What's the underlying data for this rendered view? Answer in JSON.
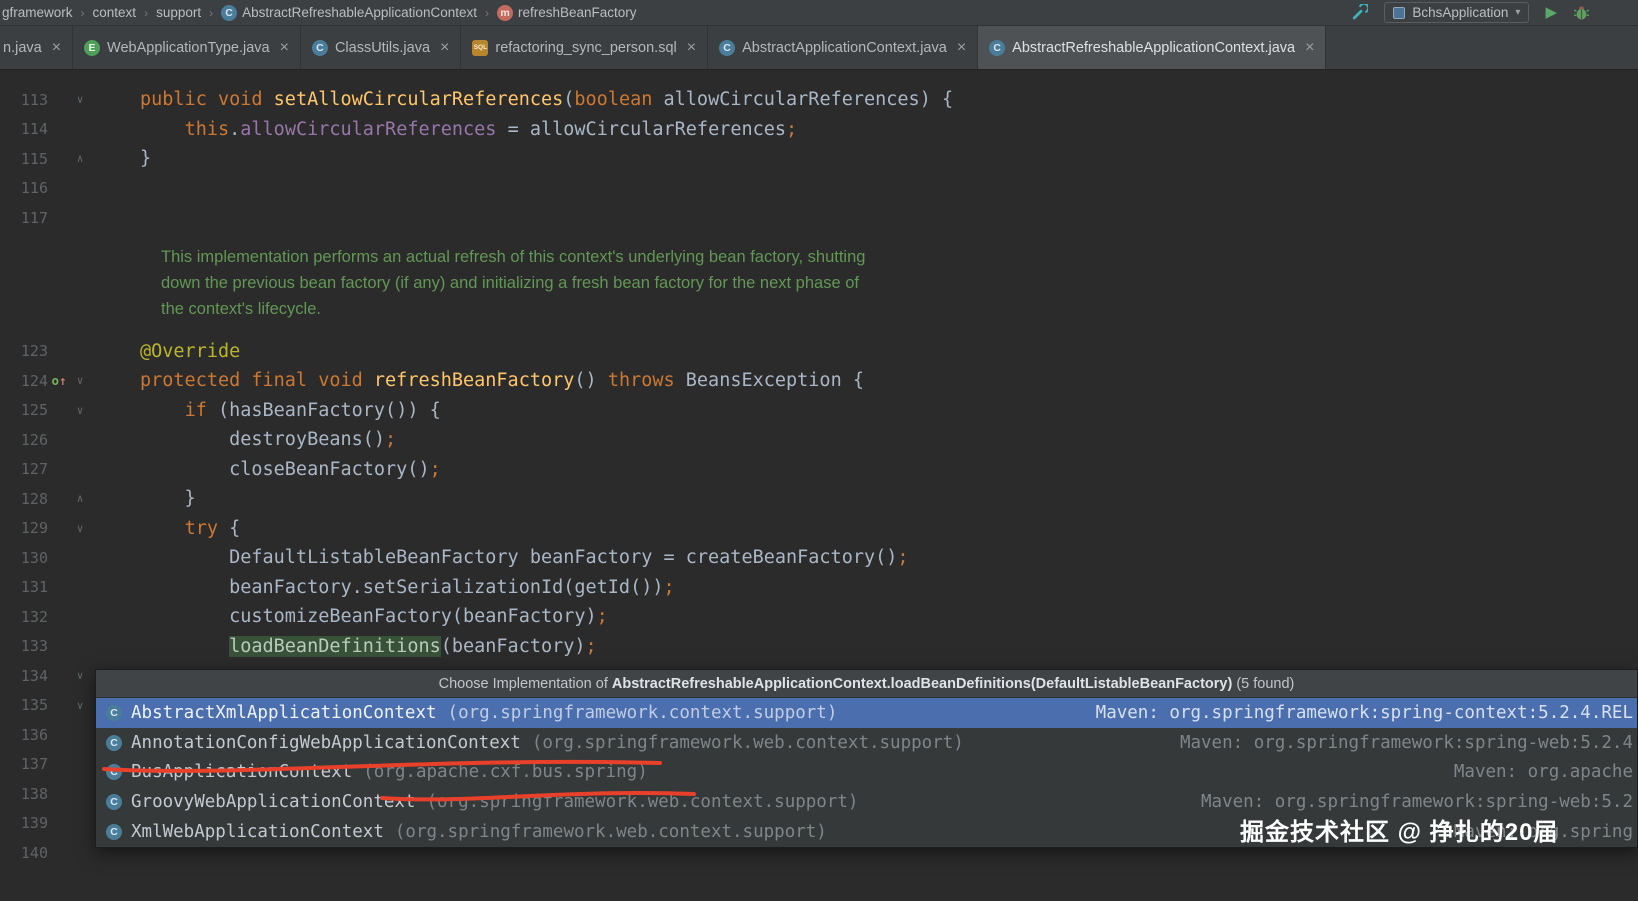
{
  "theme": {
    "editor_bg": "#2b2b2b",
    "panel_bg": "#3c3f41",
    "selection_blue": "#4b6eaf",
    "keyword_orange": "#cc7832",
    "method_decl_yellow": "#ffc66b",
    "plain_text": "#a9b7c6",
    "field_purple": "#9876aa",
    "annotation_yellow": "#bbb529",
    "doc_comment_green": "#629755",
    "line_number_gray": "#606366",
    "usage_highlight_green": "#375239",
    "annotation_red": "#e8402a",
    "run_green": "#59a869"
  },
  "icons": {
    "class": {
      "glyph": "C",
      "bg": "#4a7d9a",
      "fg": "#d6e9f5",
      "shape": "circle"
    },
    "enum": {
      "glyph": "E",
      "bg": "#4f9e59",
      "fg": "#e2f3e4",
      "shape": "circle"
    },
    "method": {
      "glyph": "m",
      "bg": "#c56b5d",
      "fg": "#f7e3df",
      "shape": "circle"
    },
    "sql": {
      "glyph": "SQL",
      "bg": "#b8862c",
      "fg": "#f5ead2",
      "shape": "square"
    },
    "close": {
      "glyph": "×"
    },
    "dropdown": {
      "glyph": "▾"
    },
    "run": {
      "glyph": "▶"
    },
    "fold_down": {
      "glyph": "∨"
    },
    "fold_up": {
      "glyph": "∧"
    },
    "override": {
      "glyph": "o↑"
    }
  },
  "breadcrumbs": {
    "separator": "›",
    "items": [
      {
        "label": "gframework"
      },
      {
        "label": "context"
      },
      {
        "label": "support"
      },
      {
        "label": "AbstractRefreshableApplicationContext",
        "icon": "class"
      },
      {
        "label": "refreshBeanFactory",
        "icon": "method"
      }
    ]
  },
  "toolbar": {
    "run_config": "BchsApplication"
  },
  "tabs": [
    {
      "label": "n.java",
      "icon": null,
      "active": false
    },
    {
      "label": "WebApplicationType.java",
      "icon": "enum",
      "active": false
    },
    {
      "label": "ClassUtils.java",
      "icon": "class",
      "active": false
    },
    {
      "label": "refactoring_sync_person.sql",
      "icon": "sql",
      "active": false
    },
    {
      "label": "AbstractApplicationContext.java",
      "icon": "class",
      "active": false
    },
    {
      "label": "AbstractRefreshableApplicationContext.java",
      "icon": "class",
      "active": true
    }
  ],
  "editor": {
    "rows": [
      {
        "num": "113",
        "fold": "down",
        "segs": [
          {
            "c": "kw",
            "t": "public "
          },
          {
            "c": "kw",
            "t": "void "
          },
          {
            "c": "decl",
            "t": "setAllowCircularReferences"
          },
          {
            "c": "plain",
            "t": "("
          },
          {
            "c": "kw",
            "t": "boolean "
          },
          {
            "c": "plain",
            "t": "allowCircularReferences) {"
          }
        ]
      },
      {
        "num": "114",
        "segs": [
          {
            "c": "plain",
            "t": "    "
          },
          {
            "c": "kw",
            "t": "this"
          },
          {
            "c": "plain",
            "t": "."
          },
          {
            "c": "field",
            "t": "allowCircularReferences"
          },
          {
            "c": "plain",
            "t": " = allowCircularReferences"
          },
          {
            "c": "semi",
            "t": ";"
          }
        ]
      },
      {
        "num": "115",
        "fold": "up",
        "segs": [
          {
            "c": "plain",
            "t": "}"
          }
        ]
      },
      {
        "num": "116",
        "segs": []
      },
      {
        "num": "117",
        "segs": []
      },
      {
        "kind": "spacer",
        "h": 12
      },
      {
        "kind": "doc",
        "text": "This implementation performs an actual refresh of this context's underlying bean factory, shutting"
      },
      {
        "kind": "doc",
        "text": "down the previous bean factory (if any) and initializing a fresh bean factory for the next phase of"
      },
      {
        "kind": "doc",
        "text": "the context's lifecycle."
      },
      {
        "kind": "spacer",
        "h": 14
      },
      {
        "num": "123",
        "segs": [
          {
            "c": "ann",
            "t": "@Override"
          }
        ]
      },
      {
        "num": "124",
        "fold": "down",
        "override": true,
        "segs": [
          {
            "c": "kw",
            "t": "protected final void "
          },
          {
            "c": "decl",
            "t": "refreshBeanFactory"
          },
          {
            "c": "plain",
            "t": "() "
          },
          {
            "c": "kw",
            "t": "throws "
          },
          {
            "c": "plain",
            "t": "BeansException {"
          }
        ]
      },
      {
        "num": "125",
        "fold": "down",
        "segs": [
          {
            "c": "plain",
            "t": "    "
          },
          {
            "c": "kw",
            "t": "if "
          },
          {
            "c": "plain",
            "t": "(hasBeanFactory()) {"
          }
        ]
      },
      {
        "num": "126",
        "segs": [
          {
            "c": "plain",
            "t": "        destroyBeans()"
          },
          {
            "c": "semi",
            "t": ";"
          }
        ]
      },
      {
        "num": "127",
        "segs": [
          {
            "c": "plain",
            "t": "        closeBeanFactory()"
          },
          {
            "c": "semi",
            "t": ";"
          }
        ]
      },
      {
        "num": "128",
        "fold": "up",
        "segs": [
          {
            "c": "plain",
            "t": "    }"
          }
        ]
      },
      {
        "num": "129",
        "fold": "down",
        "segs": [
          {
            "c": "plain",
            "t": "    "
          },
          {
            "c": "kw",
            "t": "try "
          },
          {
            "c": "plain",
            "t": "{"
          }
        ]
      },
      {
        "num": "130",
        "segs": [
          {
            "c": "plain",
            "t": "        DefaultListableBeanFactory beanFactory = createBeanFactory()"
          },
          {
            "c": "semi",
            "t": ";"
          }
        ]
      },
      {
        "num": "131",
        "segs": [
          {
            "c": "plain",
            "t": "        beanFactory.setSerializationId(getId())"
          },
          {
            "c": "semi",
            "t": ";"
          }
        ]
      },
      {
        "num": "132",
        "segs": [
          {
            "c": "plain",
            "t": "        customizeBeanFactory(beanFactory)"
          },
          {
            "c": "semi",
            "t": ";"
          }
        ]
      },
      {
        "num": "133",
        "segs": [
          {
            "c": "plain",
            "t": "        "
          },
          {
            "c": "hl",
            "t": "loadBeanDefinitions"
          },
          {
            "c": "plain",
            "t": "(beanFactory)"
          },
          {
            "c": "semi",
            "t": ";"
          }
        ]
      },
      {
        "num": "134",
        "fold": "down",
        "segs": []
      },
      {
        "num": "135",
        "fold": "down",
        "segs": []
      },
      {
        "num": "136",
        "segs": []
      },
      {
        "num": "137",
        "segs": []
      },
      {
        "num": "138",
        "segs": []
      },
      {
        "num": "139",
        "segs": []
      },
      {
        "num": "140",
        "segs": []
      }
    ]
  },
  "popup": {
    "title_prefix": "Choose Implementation of ",
    "title_method": "AbstractRefreshableApplicationContext.loadBeanDefinitions(DefaultListableBeanFactory)",
    "title_suffix": " (5 found)",
    "items": [
      {
        "name": "AbstractXmlApplicationContext",
        "pkg": "(org.springframework.context.support)",
        "location": "Maven: org.springframework:spring-context:5.2.4.REL",
        "selected": true
      },
      {
        "name": "AnnotationConfigWebApplicationContext",
        "pkg": "(org.springframework.web.context.support)",
        "location": "Maven: org.springframework:spring-web:5.2.4",
        "selected": false
      },
      {
        "name": "BusApplicationContext",
        "pkg": "(org.apache.cxf.bus.spring)",
        "location": "Maven: org.apache",
        "selected": false
      },
      {
        "name": "GroovyWebApplicationContext",
        "pkg": "(org.springframework.web.context.support)",
        "location": "Maven: org.springframework:spring-web:5.2",
        "selected": false
      },
      {
        "name": "XmlWebApplicationContext",
        "pkg": "(org.springframework.web.context.support)",
        "location": "Maven: org.spring",
        "selected": false
      }
    ]
  },
  "annotations": {
    "red_marks": [
      {
        "under": "AnnotationConfigWebApplicationContext (org.springframework…)"
      },
      {
        "under": "(org.apache.cxf.bus.spring)"
      }
    ]
  },
  "watermark": "掘金技术社区 @ 挣扎的20届"
}
